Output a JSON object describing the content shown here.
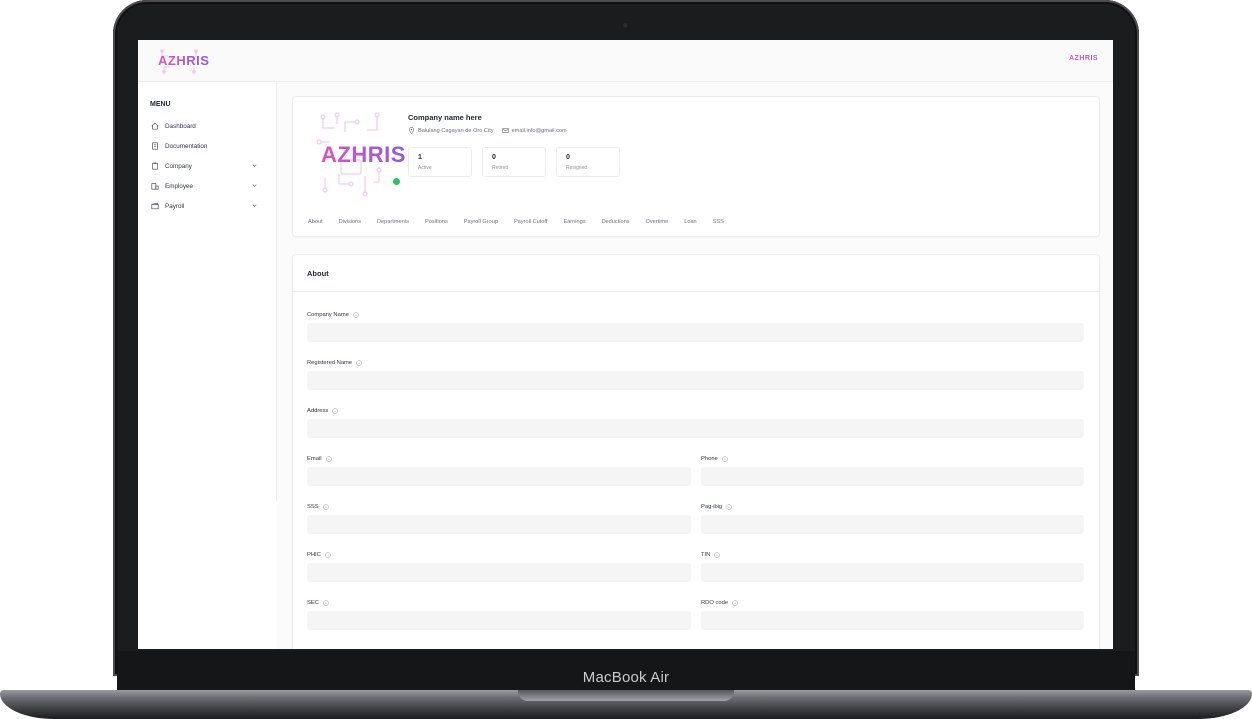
{
  "device": {
    "brand_label": "MacBook Air"
  },
  "app": {
    "logo_text": "AZHRIS",
    "avatar_text": "AZHRIS"
  },
  "sidebar": {
    "menu_title": "MENU",
    "items": [
      {
        "label": "Dashboard",
        "icon": "home-icon",
        "has_submenu": false
      },
      {
        "label": "Documentation",
        "icon": "document-icon",
        "has_submenu": false
      },
      {
        "label": "Company",
        "icon": "clipboard-icon",
        "has_submenu": true
      },
      {
        "label": "Employee",
        "icon": "building-icon",
        "has_submenu": true
      },
      {
        "label": "Payroll",
        "icon": "wallet-icon",
        "has_submenu": true
      }
    ]
  },
  "profile": {
    "logo_text": "AZHRIS",
    "company_name": "Company name here",
    "location": "Balulang Cagayan de Oro City",
    "email": "email.info@gmail.com",
    "status_color": "#22c55e",
    "stats": [
      {
        "value": "1",
        "label": "Active"
      },
      {
        "value": "0",
        "label": "Retired"
      },
      {
        "value": "0",
        "label": "Resigned"
      }
    ],
    "tabs": [
      "About",
      "Divisions",
      "Departments",
      "Positions",
      "Payroll Group",
      "Payroll Cutoff",
      "Earnings",
      "Deductions",
      "Overtime",
      "Loan",
      "SSS"
    ]
  },
  "about": {
    "title": "About",
    "fields": {
      "company_name": {
        "label": "Company Name",
        "value": ""
      },
      "registered_name": {
        "label": "Registered Name",
        "value": ""
      },
      "address": {
        "label": "Address",
        "value": ""
      },
      "email": {
        "label": "Email",
        "value": ""
      },
      "phone": {
        "label": "Phone",
        "value": ""
      },
      "sss": {
        "label": "SSS",
        "value": ""
      },
      "pag_ibig": {
        "label": "Pag-ibig",
        "value": ""
      },
      "phic": {
        "label": "PHIC",
        "value": ""
      },
      "tin": {
        "label": "TIN",
        "value": ""
      },
      "sec": {
        "label": "SEC",
        "value": ""
      },
      "rdo_code": {
        "label": "RDO code",
        "value": ""
      }
    }
  },
  "colors": {
    "brand_gradient_start": "#e352b8",
    "brand_gradient_end": "#8a5be8",
    "online": "#22c55e"
  }
}
